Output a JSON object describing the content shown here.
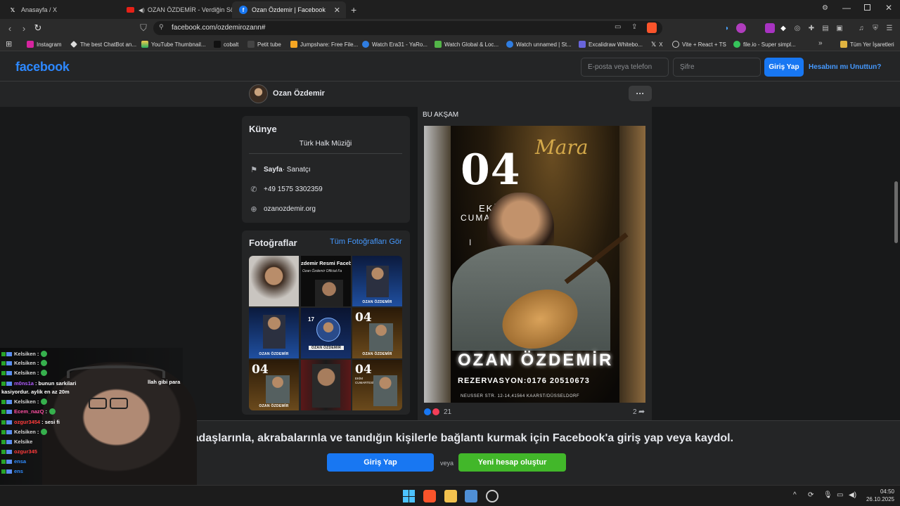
{
  "tabs": [
    {
      "title": "Anasayfa / X",
      "favicon": "x-icon"
    },
    {
      "title": "OZAN ÖZDEMİR - Verdiğin Söz Ya",
      "favicon": "youtube-icon"
    },
    {
      "title": "Ozan Özdemir | Facebook",
      "favicon": "facebook-icon",
      "active": true
    }
  ],
  "address": {
    "url": "facebook.com/ozdemirozann#"
  },
  "bookmarks": [
    "Instagram",
    "The best ChatBot an...",
    "YouTube Thumbnail...",
    "cobalt",
    "Petit tube",
    "Jumpshare: Free File...",
    "Watch Era31 - YaRo...",
    "Watch Global & Loc...",
    "Watch unnamed | St...",
    "Excalidraw Whitebo...",
    "X",
    "Vite + React + TS",
    "file.io - Super simpl..."
  ],
  "bookmarks_all": "Tüm Yer İşaretleri",
  "fb": {
    "logo": "facebook",
    "email_placeholder": "E-posta veya telefon",
    "password_placeholder": "Şifre",
    "login": "Giriş Yap",
    "forgot": "Hesabını mı Unuttun?",
    "profile_name": "Ozan Özdemir",
    "more": "···"
  },
  "intro": {
    "title": "Künye",
    "category": "Türk Halk Müziği",
    "type_label": "Sayfa",
    "type_value": " · Sanatçı",
    "phone": "+49 1575 3302359",
    "website": "ozanozdemir.org"
  },
  "photos": {
    "title": "Fotoğraflar",
    "see_all": "Tüm Fotoğrafları Gör",
    "thumb_texts": {
      "t2_top": "zdemir Resmi Faceboo",
      "t2_sub": "Ozan Özdemir Official Fa",
      "t3_cap": "OZAN ÖZDEMİR",
      "t4_cap": "OZAN ÖZDEMİR",
      "t5_num": "17",
      "t5_cap": "OZAN ÖZDEMİR",
      "t6_num": "04",
      "t6_cap": "OZAN ÖZDEMİR",
      "t7_num": "04",
      "t7_cap": "OZAN ÖZDEMİR",
      "t9_num": "04",
      "t9_sub": "EKİM CUMARTESİ"
    }
  },
  "post": {
    "header": "BU AKŞAM",
    "poster": {
      "script": "Mara",
      "date_num": "04",
      "month": "EKİM",
      "day": "CUMARTESİ",
      "name": "OZAN ÖZDEMİR",
      "reservation": "REZERVASYON:0176 20510673",
      "address": "NEUSSER STR. 12-14,41564 KAARST/DÜSSELDORF"
    },
    "reactions_count": "21",
    "shares_count": "2"
  },
  "signup": {
    "text": "Arkadaşlarınla, akrabalarınla ve tanıdığın kişilerle bağlantı kurmak için Facebook'a giriş yap veya kaydol.",
    "login": "Giriş Yap",
    "or": "veya",
    "create": "Yeni hesap oluştur"
  },
  "chat": [
    {
      "user": "Kelsiken",
      "msg": ":",
      "color": "#d6d6d6"
    },
    {
      "user": "Kelsiken",
      "msg": ":",
      "color": "#d6d6d6"
    },
    {
      "user": "Kelsiken",
      "msg": ":",
      "color": "#d6d6d6"
    },
    {
      "user": "m0ns1a",
      "msg": ": bunun sarkilari",
      "color": "#b15cff"
    },
    {
      "user": "",
      "msg": "kasiyordur. aylik en az 20m",
      "color": "#ffffff"
    },
    {
      "user": "Kelsiken",
      "msg": ":",
      "color": "#d6d6d6"
    },
    {
      "user": "Ecem_nazQ",
      "msg": ":",
      "color": "#ff4fa3"
    },
    {
      "user": "ozgur3454",
      "msg": ": sesi fi",
      "color": "#ff3b3b"
    },
    {
      "user": "Kelsiken",
      "msg": ":",
      "color": "#d6d6d6"
    },
    {
      "user": "Kelsike",
      "msg": "",
      "color": "#d6d6d6"
    },
    {
      "user": "ozgur345",
      "msg": "",
      "color": "#ff3b3b"
    },
    {
      "user": "ensa",
      "msg": "",
      "color": "#2f8cff"
    },
    {
      "user": "ens",
      "msg": "",
      "color": "#2f8cff"
    }
  ],
  "chat_tail": "llah gibi para",
  "taskbar": {
    "time": "04:50",
    "date": "26.10.2025"
  },
  "colors": {
    "fb_blue": "#1877f2",
    "fb_green": "#42b72a",
    "bg_dark": "#18191a",
    "card": "#242526"
  }
}
